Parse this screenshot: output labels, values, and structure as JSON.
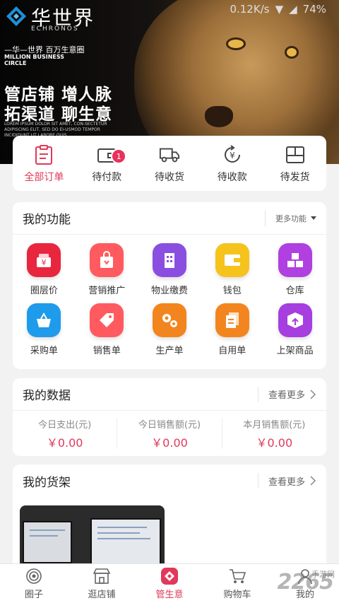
{
  "banner": {
    "brand_name": "华世界",
    "brand_sub": "ECHRONOS",
    "slogan_small": "—华—世界 百万生意圈",
    "slogan_en": "MILLION BUSINESS CIRCLE",
    "headline_1": "管店铺 增人脉",
    "headline_2": "拓渠道 聊生意",
    "lorem": "LOREM IPSUM DOLOR SIT AMET, CON-SECTETUR ADIPISCING ELIT, SED DO EI-USMOD TEMPOR INCIDIDUNT UT LABORE QUIS"
  },
  "statusbar": {
    "speed": "0.12K/s",
    "battery": "74%"
  },
  "orders": [
    {
      "label": "全部订单",
      "icon": "clipboard-icon",
      "active": true
    },
    {
      "label": "待付款",
      "icon": "wallet-icon",
      "badge": "1"
    },
    {
      "label": "待收货",
      "icon": "truck-icon"
    },
    {
      "label": "待收款",
      "icon": "yuan-refresh-icon"
    },
    {
      "label": "待发货",
      "icon": "box-icon"
    }
  ],
  "functions": {
    "title": "我的功能",
    "more": "更多功能",
    "items": [
      {
        "label": "圈层价",
        "icon": "price-tag-icon",
        "color": "#e8263d"
      },
      {
        "label": "营销推广",
        "icon": "shopping-bag-icon",
        "color": "#ff5a5f"
      },
      {
        "label": "物业缴费",
        "icon": "building-icon",
        "color": "#8a4fe0"
      },
      {
        "label": "钱包",
        "icon": "wallet-icon",
        "color": "#f6c31c"
      },
      {
        "label": "仓库",
        "icon": "boxes-icon",
        "color": "#b040e0"
      },
      {
        "label": "采购单",
        "icon": "basket-icon",
        "color": "#1e9bea"
      },
      {
        "label": "销售单",
        "icon": "sale-tag-icon",
        "color": "#ff5a5f"
      },
      {
        "label": "生产单",
        "icon": "gears-icon",
        "color": "#f3851f"
      },
      {
        "label": "自用单",
        "icon": "documents-icon",
        "color": "#f3851f"
      },
      {
        "label": "上架商品",
        "icon": "package-icon",
        "color": "#a63ee0"
      }
    ]
  },
  "data": {
    "title": "我的数据",
    "more": "查看更多",
    "cols": [
      {
        "label": "今日支出(元)",
        "value": "￥0.00"
      },
      {
        "label": "今日销售额(元)",
        "value": "￥0.00"
      },
      {
        "label": "本月销售额(元)",
        "value": "￥0.00"
      }
    ]
  },
  "shelf": {
    "title": "我的货架",
    "more": "查看更多"
  },
  "nav": [
    {
      "label": "圈子",
      "icon": "circle-icon"
    },
    {
      "label": "逛店铺",
      "icon": "store-icon"
    },
    {
      "label": "管生意",
      "icon": "business-icon",
      "active": true
    },
    {
      "label": "购物车",
      "icon": "cart-icon"
    },
    {
      "label": "我的",
      "icon": "user-icon"
    }
  ],
  "watermark": {
    "text": "2265",
    "sub": "手游网"
  },
  "colors": {
    "accent": "#e0395a",
    "badge": "#e8315b"
  }
}
